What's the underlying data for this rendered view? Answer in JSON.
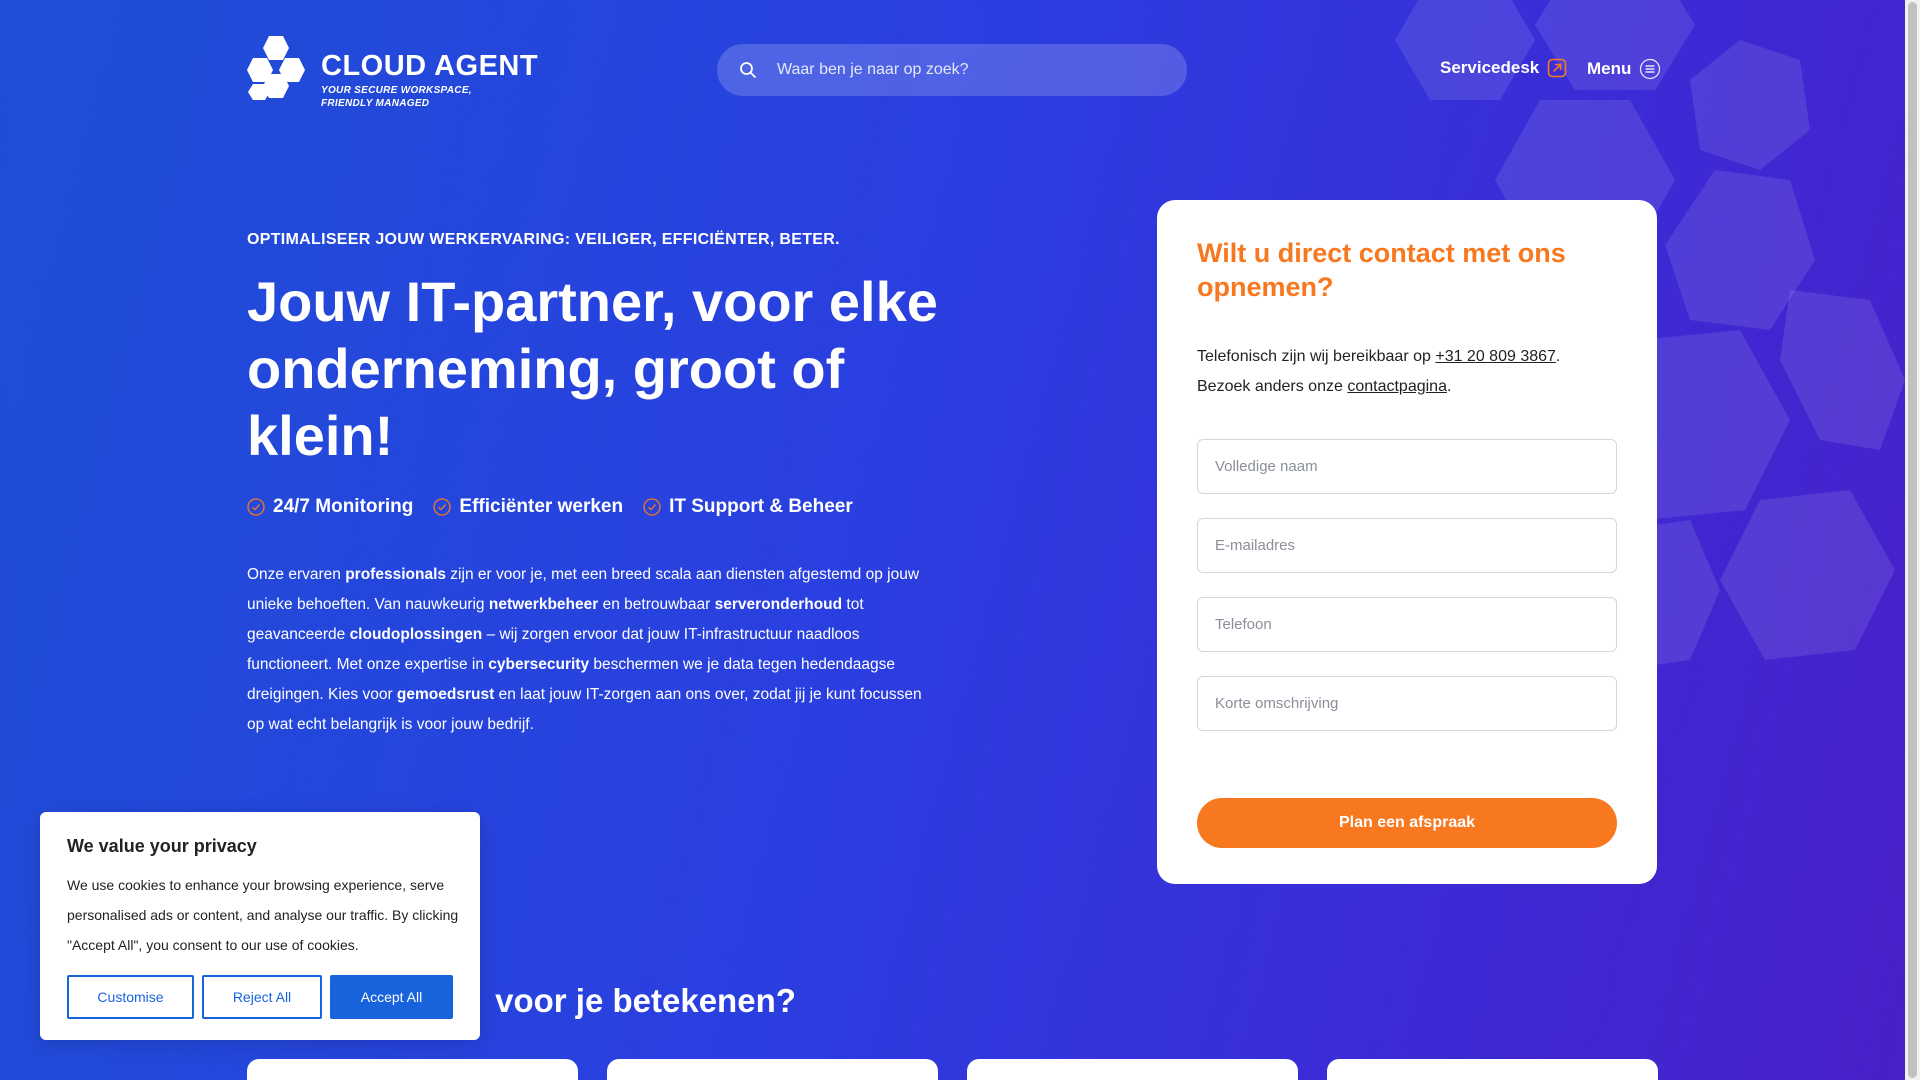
{
  "header": {
    "logo_name": "CLOUD AGENT",
    "logo_tag_line1": "YOUR SECURE WORKSPACE,",
    "logo_tag_line2": "FRIENDLY MANAGED",
    "search_placeholder": "Waar ben je naar op zoek?",
    "servicedesk_label": "Servicedesk",
    "menu_label": "Menu"
  },
  "hero": {
    "eyebrow": "OPTIMALISEER JOUW WERKERVARING: VEILIGER, EFFICIËNTER, BETER.",
    "title": "Jouw IT-partner, voor elke onderneming, groot of klein!",
    "checks": [
      "24/7 Monitoring",
      "Efficiënter werken",
      "IT Support & Beheer"
    ],
    "body": [
      {
        "t": "Onze ervaren ",
        "b": false
      },
      {
        "t": "professionals",
        "b": true
      },
      {
        "t": " zijn er voor je, met een breed scala aan diensten afgestemd op jouw unieke behoeften. Van nauwkeurig ",
        "b": false
      },
      {
        "t": "netwerkbeheer",
        "b": true
      },
      {
        "t": " en betrouwbaar ",
        "b": false
      },
      {
        "t": "serveronderhoud",
        "b": true
      },
      {
        "t": " tot geavanceerde ",
        "b": false
      },
      {
        "t": "cloudoplossingen",
        "b": true
      },
      {
        "t": " – wij zorgen ervoor dat jouw IT-infrastructuur naadloos functioneert. Met onze expertise in ",
        "b": false
      },
      {
        "t": "cybersecurity",
        "b": true
      },
      {
        "t": " beschermen we je data tegen hedendaagse dreigingen. Kies voor ",
        "b": false
      },
      {
        "t": "gemoedsrust",
        "b": true
      },
      {
        "t": " en laat jouw IT-zorgen aan ons over, zodat jij je kunt focussen op wat echt belangrijk is voor jouw bedrijf.",
        "b": false
      }
    ],
    "section_title_visible": "voor je betekenen?"
  },
  "contact": {
    "title": "Wilt u direct contact met ons opnemen?",
    "phone_prefix": "Telefonisch zijn wij bereikbaar op ",
    "phone": "+31 20 809 3867",
    "phone_suffix": ".",
    "visit_prefix": "Bezoek anders onze ",
    "visit_link": "contactpagina",
    "visit_suffix": ".",
    "fields": {
      "name": "Volledige naam",
      "email": "E-mailadres",
      "phone": "Telefoon",
      "description": "Korte omschrijving"
    },
    "submit_label": "Plan een afspraak"
  },
  "cookie": {
    "title": "We value your privacy",
    "text": "We use cookies to enhance your browsing experience, serve personalised ads or content, and analyse our traffic. By clicking \"Accept All\", you consent to our use of cookies.",
    "customise_label": "Customise",
    "reject_label": "Reject All",
    "accept_label": "Accept All"
  },
  "colors": {
    "accent_orange": "#f7781f",
    "cookie_blue": "#1863dc",
    "bg_blue": "#2a3fe0",
    "bg_purple": "#4a1fc7"
  },
  "icons": {
    "search": "search-icon",
    "servicedesk": "external-link-icon",
    "menu": "menu-lines-icon",
    "check": "check-circle-icon",
    "logo": "hexagon-cluster-logo"
  }
}
